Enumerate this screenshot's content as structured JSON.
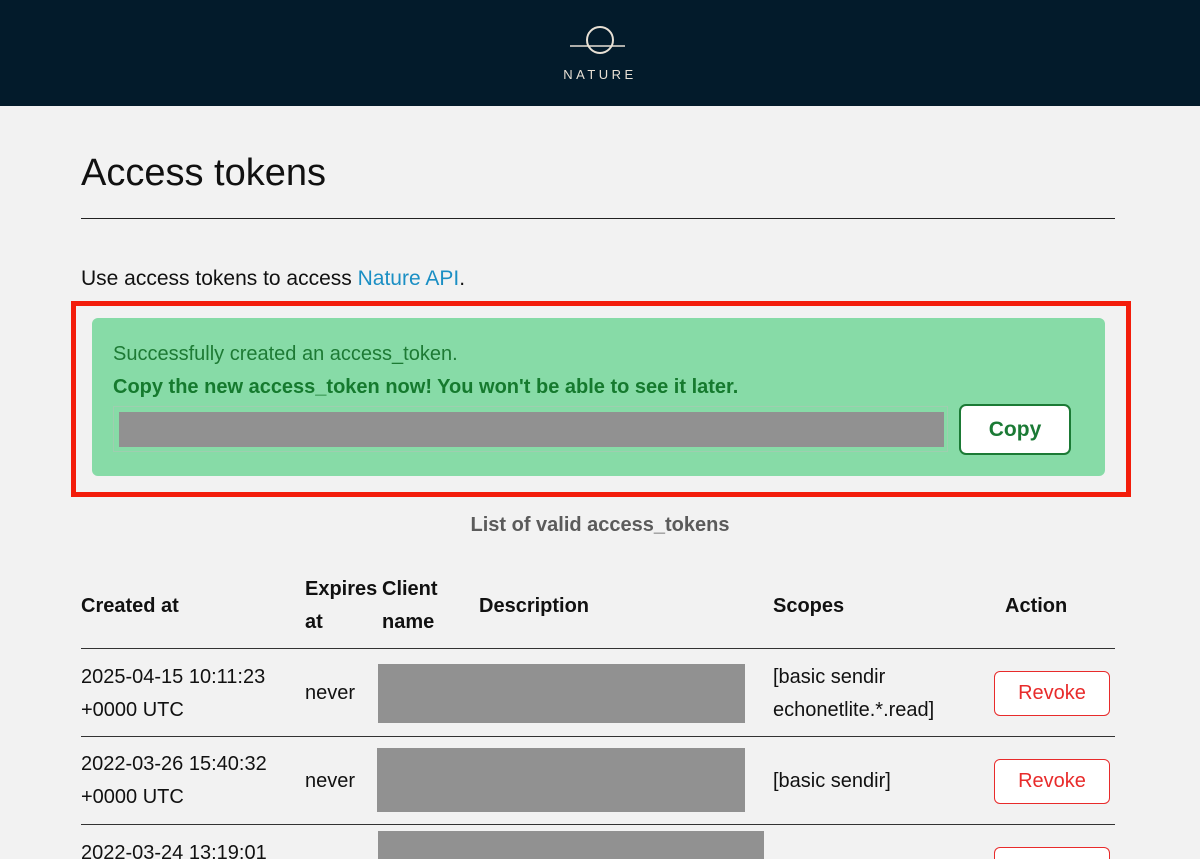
{
  "brand": {
    "name": "NATURE",
    "logo_icon": "planet-horizon-icon"
  },
  "page": {
    "title": "Access tokens",
    "intro_prefix": "Use access tokens to access ",
    "intro_link": "Nature API",
    "intro_suffix": "."
  },
  "alert": {
    "message": "Successfully created an access_token.",
    "warning": "Copy the new access_token now! You won't be able to see it later.",
    "copy_label": "Copy"
  },
  "list": {
    "caption": "List of valid access_tokens",
    "headers": {
      "created_at": "Created at",
      "expires_at_line1": "Expires",
      "expires_at_line2": "at",
      "client_name_line1": "Client",
      "client_name_line2": "name",
      "description": "Description",
      "scopes": "Scopes",
      "action": "Action"
    },
    "rows": [
      {
        "created_line1": "2025-04-15 10:11:23",
        "created_line2": "+0000 UTC",
        "expires": "never",
        "scopes_line1": "[basic sendir",
        "scopes_line2": "echonetlite.*.read]",
        "action": "Revoke"
      },
      {
        "created_line1": "2022-03-26 15:40:32",
        "created_line2": "+0000 UTC",
        "expires": "never",
        "scopes_line1": "[basic sendir]",
        "action": "Revoke"
      },
      {
        "created_line1": "2022-03-24 13:19:01"
      }
    ]
  },
  "colors": {
    "header_bg": "#031b2b",
    "alert_bg": "#87dba7",
    "highlight": "#f31d0b",
    "link": "#1b8fc4",
    "revoke": "#e82b2b"
  }
}
